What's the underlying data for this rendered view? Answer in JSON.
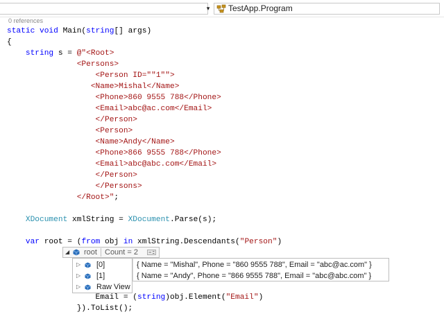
{
  "navbar": {
    "dropdown_arrow_glyph": "▾",
    "class_name": "TestApp.Program"
  },
  "editor": {
    "references_label": "0 references",
    "lines": [
      [
        [
          "kw",
          "static "
        ],
        [
          "kw",
          "void "
        ],
        [
          "tx",
          "Main("
        ],
        [
          "kw",
          "string"
        ],
        [
          "tx",
          "[] args)"
        ]
      ],
      [
        [
          "tx",
          "{"
        ]
      ],
      [
        [
          "tx",
          "    "
        ],
        [
          "kw",
          "string "
        ],
        [
          "tx",
          "s = "
        ],
        [
          "st",
          "@\"<Root>"
        ]
      ],
      [
        [
          "st",
          "               <Persons>"
        ]
      ],
      [
        [
          "st",
          "                   <Person ID=\"\"1\"\">"
        ]
      ],
      [
        [
          "st",
          "                  <Name>Mishal</Name>"
        ]
      ],
      [
        [
          "st",
          "                   <Phone>860 9555 788</Phone>"
        ]
      ],
      [
        [
          "st",
          "                   <Email>abc@ac.com</Email>"
        ]
      ],
      [
        [
          "st",
          "                   </Person>"
        ]
      ],
      [
        [
          "st",
          "                   <Person>"
        ]
      ],
      [
        [
          "st",
          "                   <Name>Andy</Name>"
        ]
      ],
      [
        [
          "st",
          "                   <Phone>866 9555 788</Phone>"
        ]
      ],
      [
        [
          "st",
          "                   <Email>abc@abc.com</Email>"
        ]
      ],
      [
        [
          "st",
          "                   </Person>"
        ]
      ],
      [
        [
          "st",
          "                   </Persons>"
        ]
      ],
      [
        [
          "st",
          "               </Root>\""
        ],
        [
          "tx",
          ";"
        ]
      ],
      [],
      [
        [
          "tx",
          "    "
        ],
        [
          "tp",
          "XDocument "
        ],
        [
          "tx",
          "xmlString = "
        ],
        [
          "tp",
          "XDocument"
        ],
        [
          "tx",
          ".Parse(s);"
        ]
      ],
      [],
      [
        [
          "tx",
          "    "
        ],
        [
          "kw",
          "var "
        ],
        [
          "tx",
          "root = ("
        ],
        [
          "kw",
          "from "
        ],
        [
          "tx",
          "obj "
        ],
        [
          "kw",
          "in "
        ],
        [
          "tx",
          "xmlString.Descendants("
        ],
        [
          "st",
          "\"Person\""
        ],
        [
          "tx",
          ")"
        ]
      ],
      [],
      [],
      [],
      [],
      [
        [
          "tx",
          "                   Email = ("
        ],
        [
          "kw",
          "string"
        ],
        [
          "tx",
          ")obj.Element("
        ],
        [
          "st",
          "\"Email\""
        ],
        [
          "tx",
          ")"
        ]
      ],
      [
        [
          "tx",
          "               }).ToList();"
        ]
      ]
    ]
  },
  "datatip": {
    "collapse_glyph": "◢",
    "expand_glyph": "▷",
    "root_name": "root",
    "root_value": "Count = 2",
    "items": [
      {
        "name": "[0]",
        "value": "{ Name = \"Mishal\", Phone = \"860 9555 788\", Email = \"abc@ac.com\" }"
      },
      {
        "name": "[1]",
        "value": "{ Name = \"Andy\", Phone = \"866 9555 788\", Email = \"abc@abc.com\" }"
      }
    ],
    "raw_view_label": "Raw View"
  },
  "colors": {
    "keyword": "#0000ff",
    "type": "#2b91af",
    "string": "#a31515",
    "text": "#000000",
    "object_icon": "#2a6ebb"
  }
}
